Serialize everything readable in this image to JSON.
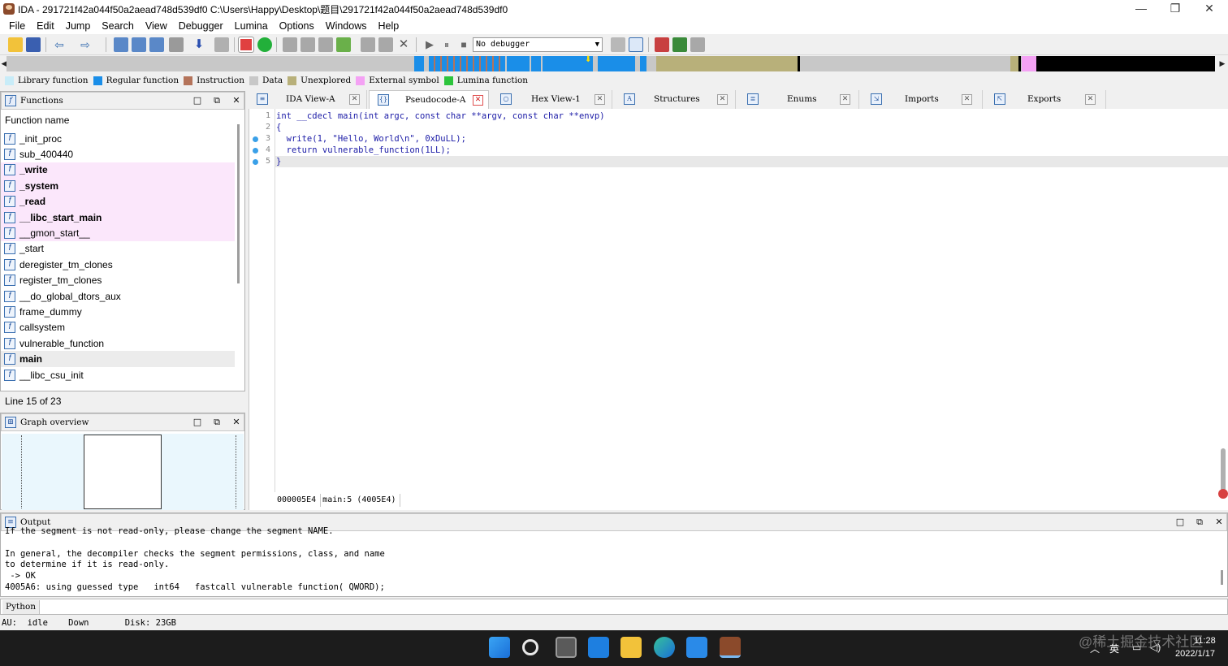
{
  "window": {
    "title": "IDA - 291721f42a044f50a2aead748d539df0 C:\\Users\\Happy\\Desktop\\题目\\291721f42a044f50a2aead748d539df0",
    "minimize": "—",
    "restore": "❐",
    "close": "✕"
  },
  "menu": [
    "File",
    "Edit",
    "Jump",
    "Search",
    "View",
    "Debugger",
    "Lumina",
    "Options",
    "Windows",
    "Help"
  ],
  "toolbar": {
    "debugger_value": "No debugger"
  },
  "legend": [
    {
      "label": "Library function",
      "color": "#c8ecf8"
    },
    {
      "label": "Regular function",
      "color": "#1a8ee8"
    },
    {
      "label": "Instruction",
      "color": "#b4735a"
    },
    {
      "label": "Data",
      "color": "#c8c8c8"
    },
    {
      "label": "Unexplored",
      "color": "#b8b07a"
    },
    {
      "label": "External symbol",
      "color": "#f4a2f4"
    },
    {
      "label": "Lumina function",
      "color": "#2cc43c"
    }
  ],
  "functions_panel": {
    "title": "Functions",
    "column_header": "Function name",
    "items": [
      {
        "name": "_init_proc",
        "kind": "regular"
      },
      {
        "name": "sub_400440",
        "kind": "regular"
      },
      {
        "name": "_write",
        "kind": "library"
      },
      {
        "name": "_system",
        "kind": "library"
      },
      {
        "name": "_read",
        "kind": "library"
      },
      {
        "name": "__libc_start_main",
        "kind": "library"
      },
      {
        "name": "__gmon_start__",
        "kind": "external"
      },
      {
        "name": "_start",
        "kind": "regular"
      },
      {
        "name": "deregister_tm_clones",
        "kind": "regular"
      },
      {
        "name": "register_tm_clones",
        "kind": "regular"
      },
      {
        "name": "__do_global_dtors_aux",
        "kind": "regular"
      },
      {
        "name": "frame_dummy",
        "kind": "regular"
      },
      {
        "name": "callsystem",
        "kind": "regular"
      },
      {
        "name": "vulnerable_function",
        "kind": "regular"
      },
      {
        "name": "main",
        "kind": "selected"
      },
      {
        "name": "__libc_csu_init",
        "kind": "regular"
      }
    ],
    "status": "Line 15 of 23"
  },
  "graph_panel": {
    "title": "Graph overview"
  },
  "tabs": [
    {
      "label": "IDA View-A",
      "icon": "IDA"
    },
    {
      "label": "Pseudocode-A",
      "icon": "{}"
    },
    {
      "label": "Hex View-1",
      "icon": "O"
    },
    {
      "label": "Structures",
      "icon": "A"
    },
    {
      "label": "Enums",
      "icon": "E"
    },
    {
      "label": "Imports",
      "icon": "I"
    },
    {
      "label": "Exports",
      "icon": "X"
    }
  ],
  "pseudocode": {
    "lines": [
      {
        "num": "1",
        "text": "int __cdecl main(int argc, const char **argv, const char **envp)",
        "bp": false
      },
      {
        "num": "2",
        "text": "{",
        "bp": false
      },
      {
        "num": "3",
        "text": "  write(1, \"Hello, World\\n\", 0xDuLL);",
        "bp": true
      },
      {
        "num": "4",
        "text": "  return vulnerable_function(1LL);",
        "bp": true
      },
      {
        "num": "5",
        "text": "}",
        "bp": true
      }
    ],
    "status": [
      "000005E4",
      "main:5 (4005E4)"
    ]
  },
  "output_panel": {
    "title": "Output",
    "lines": [
      "If the segment is not read-only, please change the segment NAME.",
      "",
      "In general, the decompiler checks the segment permissions, class, and name",
      "to determine if it is read-only.",
      " -> OK",
      "4005A6: using guessed type __int64 __fastcall vulnerable_function(_QWORD);"
    ]
  },
  "python_bar": {
    "label": "Python"
  },
  "statusbar": {
    "text": "AU:  idle    Down       Disk: 23GB"
  },
  "taskbar": {
    "time": "11:28",
    "date": "2022/1/17",
    "ime": "英",
    "watermark": "@稀土掘金技术社区"
  }
}
